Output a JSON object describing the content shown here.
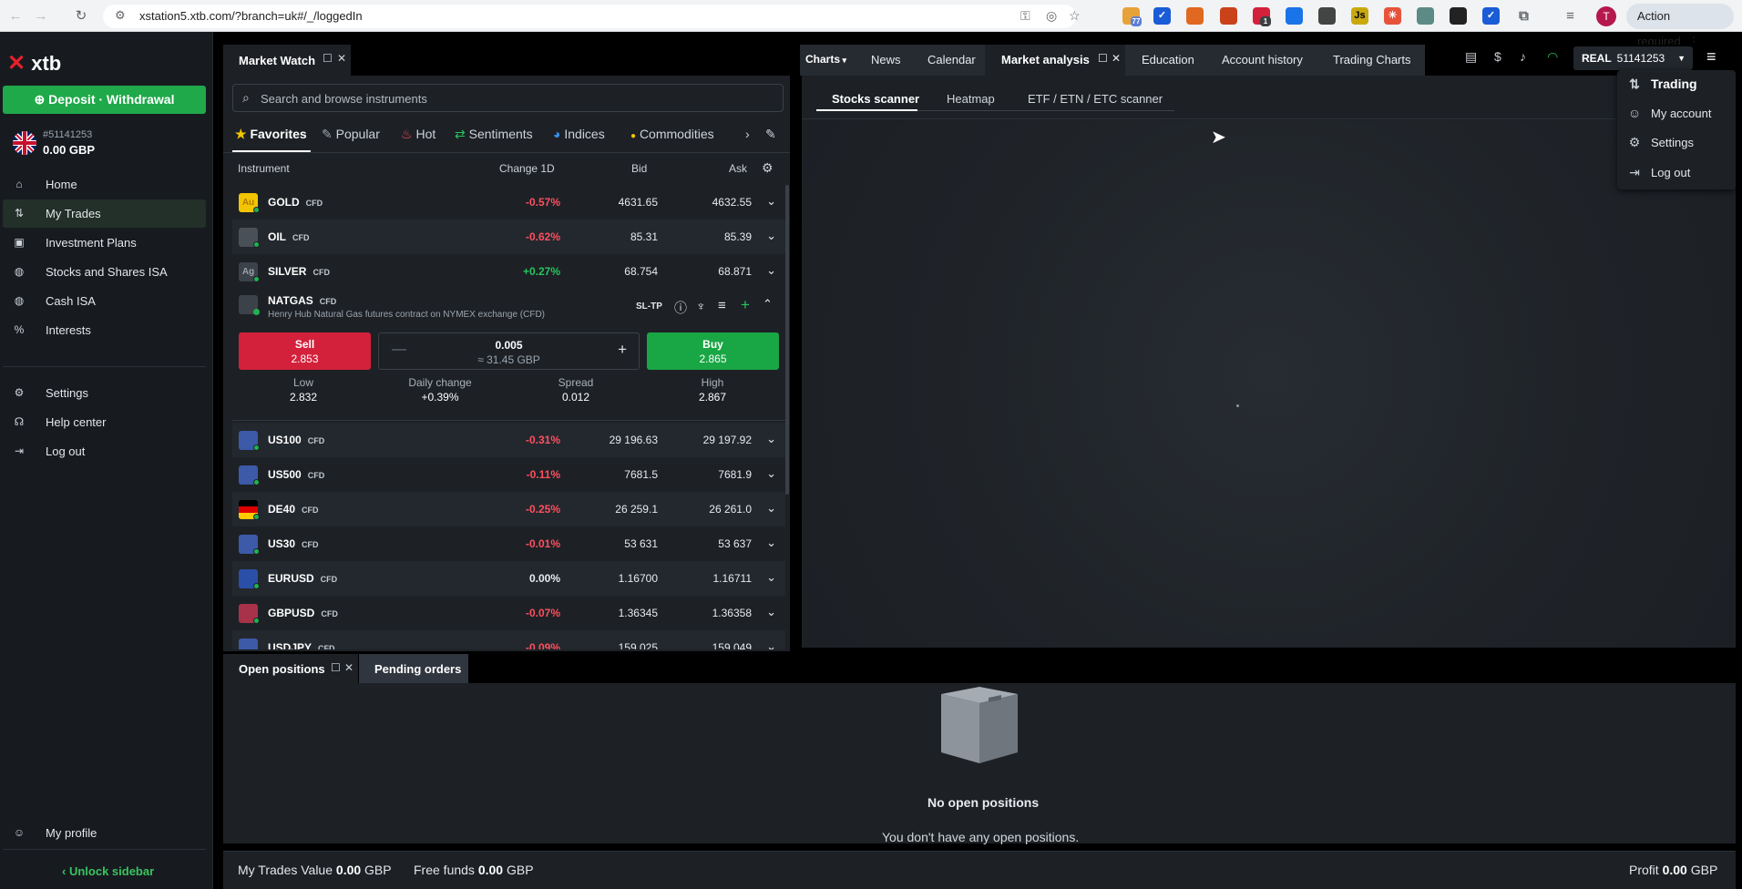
{
  "browser": {
    "url": "xstation5.xtb.com/?branch=uk#/_/loggedIn",
    "profile_initial": "T",
    "action_required": "Action required",
    "extension_badges": [
      "77",
      "1"
    ]
  },
  "sidebar": {
    "logo": "xtb",
    "deposit_label": "Deposit · Withdrawal",
    "account_number": "#51141253",
    "account_balance": "0.00 GBP",
    "items": [
      {
        "label": "Home",
        "icon": "home-icon"
      },
      {
        "label": "My Trades",
        "icon": "trades-icon"
      },
      {
        "label": "Investment Plans",
        "icon": "plans-icon"
      },
      {
        "label": "Stocks and Shares ISA",
        "icon": "isa-icon"
      },
      {
        "label": "Cash ISA",
        "icon": "cash-icon"
      },
      {
        "label": "Interests",
        "icon": "percent-icon"
      }
    ],
    "secondary": [
      {
        "label": "Settings",
        "icon": "gear-icon"
      },
      {
        "label": "Help center",
        "icon": "headset-icon"
      },
      {
        "label": "Log out",
        "icon": "logout-icon"
      }
    ],
    "profile": "My profile",
    "unlock": "Unlock sidebar"
  },
  "market_watch": {
    "title": "Market Watch",
    "search_placeholder": "Search and browse instruments",
    "categories": [
      "Favorites",
      "Popular",
      "Hot",
      "Sentiments",
      "Indices",
      "Commodities"
    ],
    "columns": {
      "instrument": "Instrument",
      "change": "Change 1D",
      "bid": "Bid",
      "ask": "Ask"
    },
    "cfd_label": "CFD",
    "rows": [
      {
        "symbol": "GOLD",
        "change": "-0.57%",
        "bid": "4631.65",
        "ask": "4632.55",
        "dir": "neg",
        "flag": "Au",
        "color": "#f2c500"
      },
      {
        "symbol": "OIL",
        "change": "-0.62%",
        "bid": "85.31",
        "ask": "85.39",
        "dir": "neg",
        "flag": "",
        "color": "#4a5058"
      },
      {
        "symbol": "SILVER",
        "change": "+0.27%",
        "bid": "68.754",
        "ask": "68.871",
        "dir": "pos",
        "flag": "Ag",
        "color": "#3c4249"
      }
    ],
    "expanded": {
      "symbol": "NATGAS",
      "description": "Henry Hub Natural Gas futures contract on NYMEX exchange (CFD)",
      "sltp": "SL-TP",
      "sell_label": "Sell",
      "sell_price": "2.853",
      "buy_label": "Buy",
      "buy_price": "2.865",
      "volume": "0.005",
      "volume_value": "≈ 31.45 GBP",
      "stats": [
        {
          "label": "Low",
          "value": "2.832"
        },
        {
          "label": "Daily change",
          "value": "+0.39%"
        },
        {
          "label": "Spread",
          "value": "0.012"
        },
        {
          "label": "High",
          "value": "2.867"
        }
      ]
    },
    "rows_after": [
      {
        "symbol": "US100",
        "change": "-0.31%",
        "bid": "29 196.63",
        "ask": "29 197.92",
        "dir": "neg"
      },
      {
        "symbol": "US500",
        "change": "-0.11%",
        "bid": "7681.5",
        "ask": "7681.9",
        "dir": "neg"
      },
      {
        "symbol": "DE40",
        "change": "-0.25%",
        "bid": "26 259.1",
        "ask": "26 261.0",
        "dir": "neg"
      },
      {
        "symbol": "US30",
        "change": "-0.01%",
        "bid": "53 631",
        "ask": "53 637",
        "dir": "neg"
      },
      {
        "symbol": "EURUSD",
        "change": "0.00%",
        "bid": "1.16700",
        "ask": "1.16711",
        "dir": "neu"
      },
      {
        "symbol": "GBPUSD",
        "change": "-0.07%",
        "bid": "1.36345",
        "ask": "1.36358",
        "dir": "neg"
      },
      {
        "symbol": "USDJPY",
        "change": "-0.09%",
        "bid": "159.025",
        "ask": "159.049",
        "dir": "neg"
      }
    ]
  },
  "top_tabs": [
    "Charts",
    "News",
    "Calendar",
    "Market analysis",
    "Education",
    "Account history",
    "Trading Charts"
  ],
  "market_analysis": {
    "subtabs": [
      "Stocks scanner",
      "Heatmap",
      "ETF / ETN / ETC scanner"
    ]
  },
  "account_selector": {
    "type": "REAL",
    "number": "51141253"
  },
  "menu": [
    "Trading",
    "My account",
    "Settings",
    "Log out"
  ],
  "bottom": {
    "tabs": [
      "Open positions",
      "Pending orders"
    ],
    "empty_title": "No open positions",
    "empty_text": "You don't have any open positions.",
    "footer": {
      "trades_label": "My Trades Value",
      "trades_value": "0.00",
      "trades_ccy": "GBP",
      "funds_label": "Free funds",
      "funds_value": "0.00",
      "funds_ccy": "GBP",
      "profit_label": "Profit",
      "profit_value": "0.00",
      "profit_ccy": "GBP"
    }
  }
}
